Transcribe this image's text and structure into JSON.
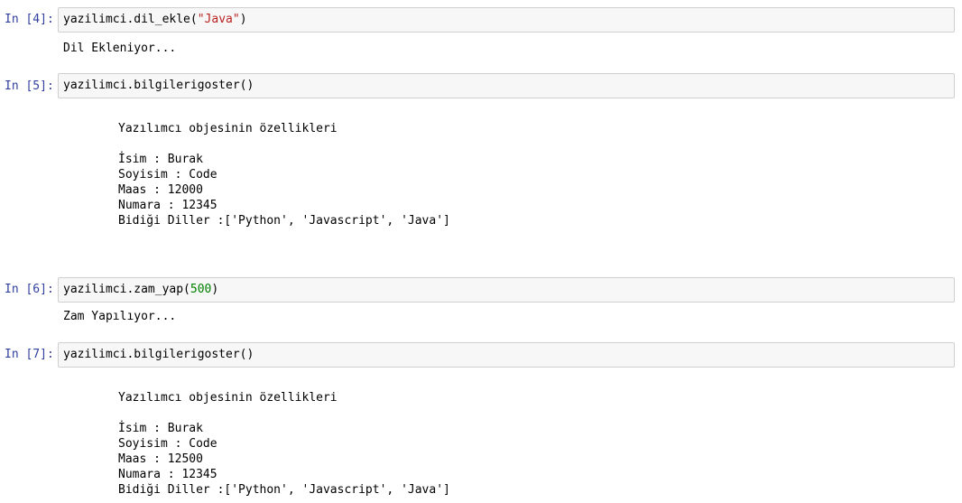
{
  "cells": [
    {
      "prompt": "In [4]:",
      "code": {
        "pre": "yazilimci.dil_ekle(",
        "arg": "\"Java\"",
        "post": ")"
      },
      "output": "Dil Ekleniyor..."
    },
    {
      "prompt": "In [5]:",
      "code": {
        "text": "yazilimci.bilgilerigoster()"
      },
      "output": {
        "heading": "Yazılımcı objesinin özellikleri",
        "lines": [
          "İsim : Burak",
          "Soyisim : Code",
          "Maas : 12000",
          "Numara : 12345",
          "Bidiği Diller :['Python', 'Javascript', 'Java']"
        ]
      }
    },
    {
      "prompt": "In [6]:",
      "code": {
        "pre": "yazilimci.zam_yap(",
        "arg": "500",
        "post": ")"
      },
      "output": "Zam Yapılıyor..."
    },
    {
      "prompt": "In [7]:",
      "code": {
        "text": "yazilimci.bilgilerigoster()"
      },
      "output": {
        "heading": "Yazılımcı objesinin özellikleri",
        "lines": [
          "İsim : Burak",
          "Soyisim : Code",
          "Maas : 12500",
          "Numara : 12345",
          "Bidiği Diller :['Python', 'Javascript', 'Java']"
        ]
      }
    }
  ],
  "colors": {
    "prompt": "#303F9F",
    "string": "#BA2121",
    "number": "#008000",
    "input_bg": "#f7f7f7",
    "input_border": "#cfcfcf"
  }
}
